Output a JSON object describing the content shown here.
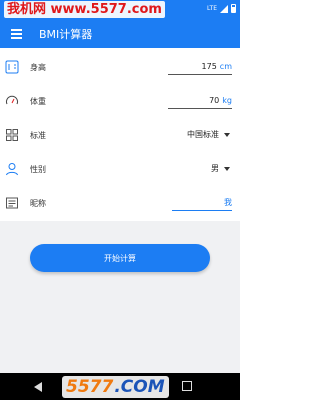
{
  "status_bar": {
    "watermark": "我机网 www.5577.com",
    "network": "LTE"
  },
  "app_bar": {
    "title": "BMI计算器",
    "menu_icon": "hamburger-menu-icon"
  },
  "form": {
    "height": {
      "label": "身高",
      "value": "175",
      "unit": "cm",
      "icon": "height-ruler-icon"
    },
    "weight": {
      "label": "体重",
      "value": "70",
      "unit": "kg",
      "icon": "scale-gauge-icon"
    },
    "standard": {
      "label": "标准",
      "selected": "中国标准",
      "icon": "grid-icon"
    },
    "gender": {
      "label": "性别",
      "selected": "男",
      "icon": "person-icon"
    },
    "nickname": {
      "label": "昵称",
      "value": "我",
      "icon": "id-card-icon"
    }
  },
  "start_button": {
    "label": "开始计算"
  },
  "nav_logo": {
    "digits": "5577",
    "suffix": ".COM"
  },
  "colors": {
    "primary": "#1c7df3",
    "background": "#f0f1f3",
    "watermark_red": "#e0181b"
  }
}
